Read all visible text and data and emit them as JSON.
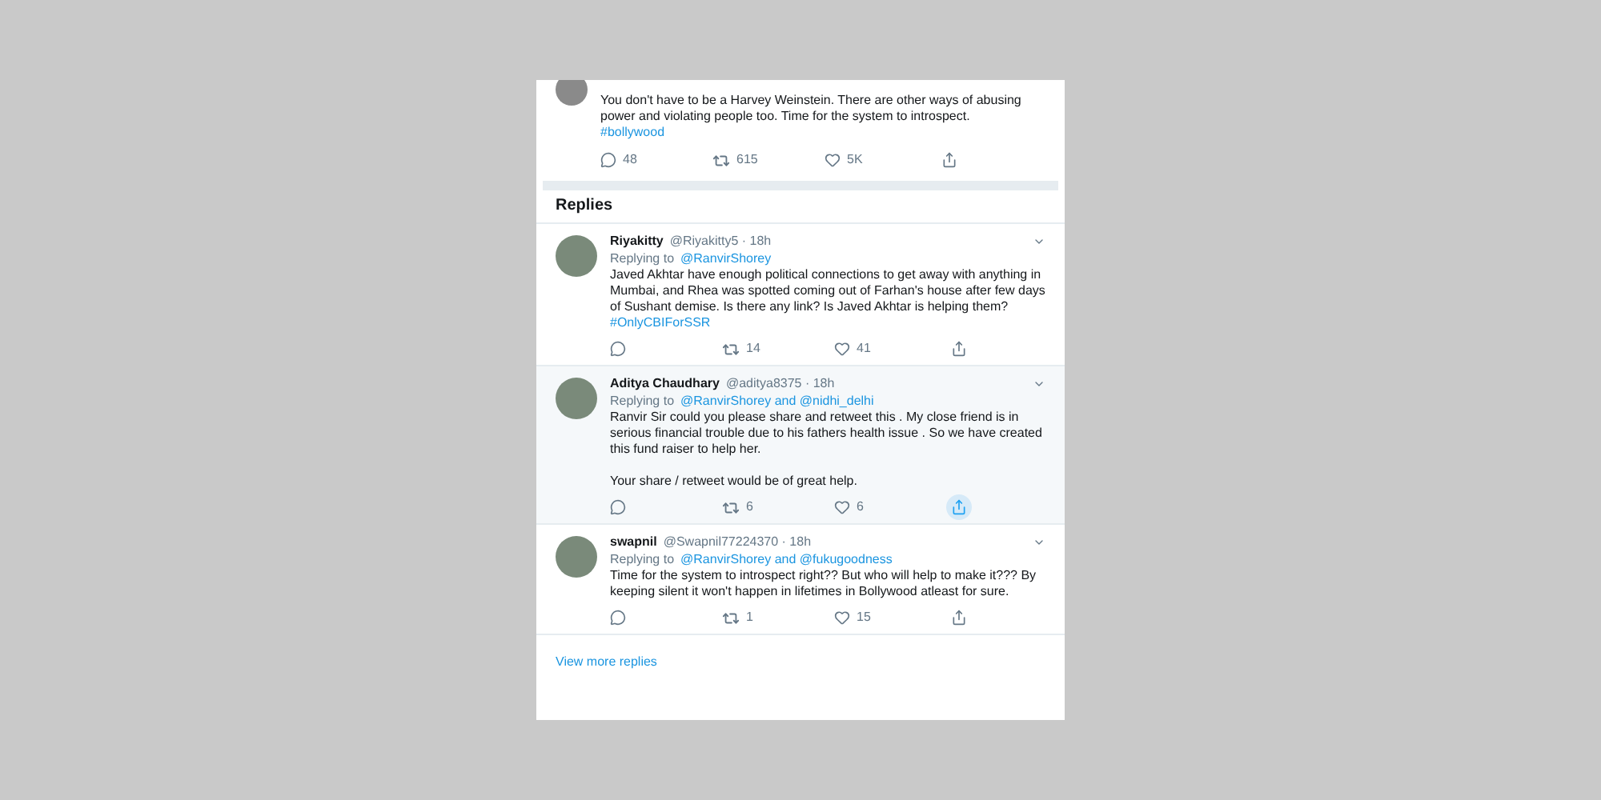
{
  "tweet": {
    "text": "You don't have to be a Harvey Weinstein. There are other ways of abusing power and violating people too. Time for the system to introspect.",
    "hashtag": "#bollywood",
    "replies": "48",
    "retweets": "615",
    "likes": "5K"
  },
  "replies_heading": "Replies",
  "replies": [
    {
      "name": "Riyakitty",
      "handle": "@Riyakitty5 · 18h",
      "replying_label": "Replying to",
      "replying_to": "@RanvirShorey",
      "paragraphs": [
        "Javed Akhtar have enough political connections to get away with anything in Mumbai, and Rhea was spotted coming out of Farhan's house after few days of Sushant demise. Is there any link? Is Javed Akhtar is helping them?"
      ],
      "hashtag": "#OnlyCBIForSSR",
      "retweets": "14",
      "likes": "41",
      "highlighted": false
    },
    {
      "name": "Aditya Chaudhary",
      "handle": "@aditya8375 · 18h",
      "replying_label": "Replying to",
      "replying_to": "@RanvirShorey and @nidhi_delhi",
      "paragraphs": [
        "Ranvir Sir could you please share and retweet  this . My close friend is in serious financial trouble due to his fathers health issue  . So we have created this fund raiser to help her.",
        "Your share / retweet would be of great help."
      ],
      "retweets": "6",
      "likes": "6",
      "highlighted": true
    },
    {
      "name": "swapnil",
      "handle": "@Swapnil77224370 · 18h",
      "replying_label": "Replying to",
      "replying_to": "@RanvirShorey and @fukugoodness",
      "paragraphs": [
        "Time for the system to introspect right?? But who will help to make it??? By keeping silent it won't happen in lifetimes in Bollywood atleast for sure."
      ],
      "retweets": "1",
      "likes": "15",
      "highlighted": false
    }
  ],
  "view_more": "View more replies"
}
